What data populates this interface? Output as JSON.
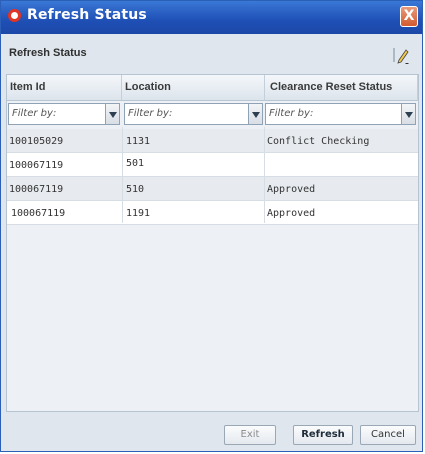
{
  "window": {
    "title": "Refresh Status",
    "close_glyph": "X"
  },
  "panel": {
    "title": "Refresh Status",
    "edit_icon": "edit-pencil-icon"
  },
  "table": {
    "columns": [
      "Item Id",
      "Location",
      "Clearance Reset  Status"
    ],
    "filter_placeholder": "Filter by:",
    "rows": [
      {
        "item_id": "100105029",
        "location": "1131",
        "status": "Conflict Checking"
      },
      {
        "item_id": "100067119",
        "location": "501",
        "status": ""
      },
      {
        "item_id": "100067119",
        "location": "510",
        "status": "Approved"
      },
      {
        "item_id": "100067119",
        "location": "1191",
        "status": "Approved"
      }
    ]
  },
  "footer": {
    "exit_label": "Exit",
    "refresh_label": "Refresh",
    "cancel_label": "Cancel"
  },
  "colors": {
    "titlebar": "#1f4fb5",
    "close": "#d35a2f",
    "accent_icon": "#e23323"
  }
}
